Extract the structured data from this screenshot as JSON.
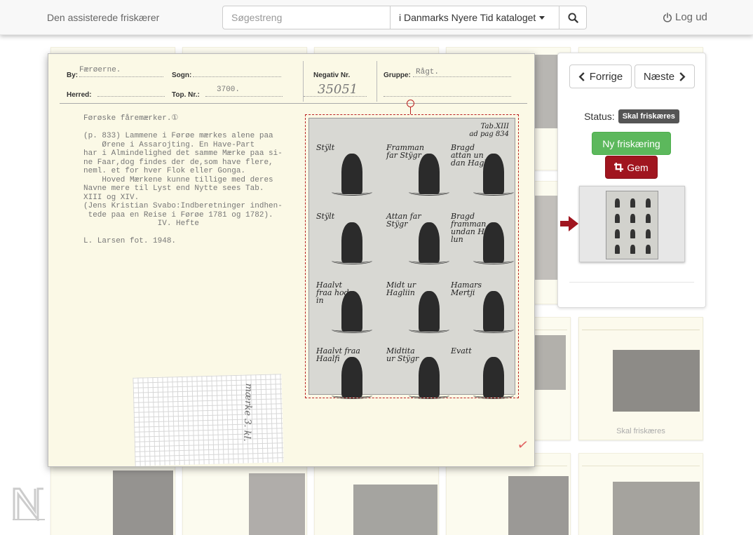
{
  "header": {
    "brand": "Den assisterede friskærer",
    "search_placeholder": "Søgestreng",
    "search_value": "",
    "catalog_label": "i Danmarks Nyere Tid kataloget",
    "search_icon": "search-icon",
    "logout_label": "Log ud",
    "logout_icon": "power-icon"
  },
  "record": {
    "by_label": "By:",
    "by_value": "Færøerne.",
    "sogn_label": "Sogn:",
    "sogn_value": "",
    "herred_label": "Herred:",
    "herred_value": "",
    "topnr_label": "Top. Nr.:",
    "topnr_value": "3700.",
    "negativ_label": "Negativ Nr.",
    "negativ_value": "35051",
    "gruppe_label": "Gruppe:",
    "gruppe_value": "Rågt.",
    "body_text": "Førøske fåremærker.①\n\n(p. 833) Lammene i Førøe mærkes alene paa\n    Ørene i Assarojting. En Have-Part\nhar i Almindelighed det samme Mærke paa si-\nne Faar,dog findes der de,som have flere,\nneml. et for hver Flok eller Gonga.\n    Hoved Mærkene kunne tillige med deres\nNavne mere til Lyst end Nytte sees Tab.\nXIII og XIV.\n(Jens Kristian Svabo:Indberetninger indhen-\n tede paa en Reise i Førøe 1781 og 1782).\n                IV. Hefte\n\nL. Larsen fot. 1948.",
    "handwritten_note": "mærke 3. kl.",
    "checkmark": "✓"
  },
  "plate": {
    "tab_label": "Tab.XIII\nad pag 834",
    "marks": [
      {
        "label": "Stÿlt"
      },
      {
        "label": "Framman\nfar Stÿgr"
      },
      {
        "label": "Bragd\nattan un\ndan Hagliin"
      },
      {
        "label": "Stÿlt"
      },
      {
        "label": "Attan far\nStÿgr"
      },
      {
        "label": "Bragd\nframman\nundan Hag\nlun"
      },
      {
        "label": "Haalvt\nfraa hod\nin"
      },
      {
        "label": "Midt ur\nHagliin"
      },
      {
        "label": "Hamars\nMertji"
      },
      {
        "label": "Haalvt fraa\nHaalfi"
      },
      {
        "label": "Midtita\nur Stÿgr"
      },
      {
        "label": "Evatt"
      }
    ]
  },
  "panel": {
    "prev_label": "Forrige",
    "next_label": "Næste",
    "status_label": "Status:",
    "status_badge": "Skal friskæres",
    "new_crop_label": "Ny friskæring",
    "save_label": "Gem",
    "save_icon": "crop-save-icon",
    "arrow_icon": "arrow-right-icon",
    "colors": {
      "success": "#5cb85c",
      "danger": "#a0151f",
      "badge": "#555555"
    }
  },
  "grid": {
    "caption": "Skal friskæres"
  },
  "logo_icon": "n-logo-icon"
}
